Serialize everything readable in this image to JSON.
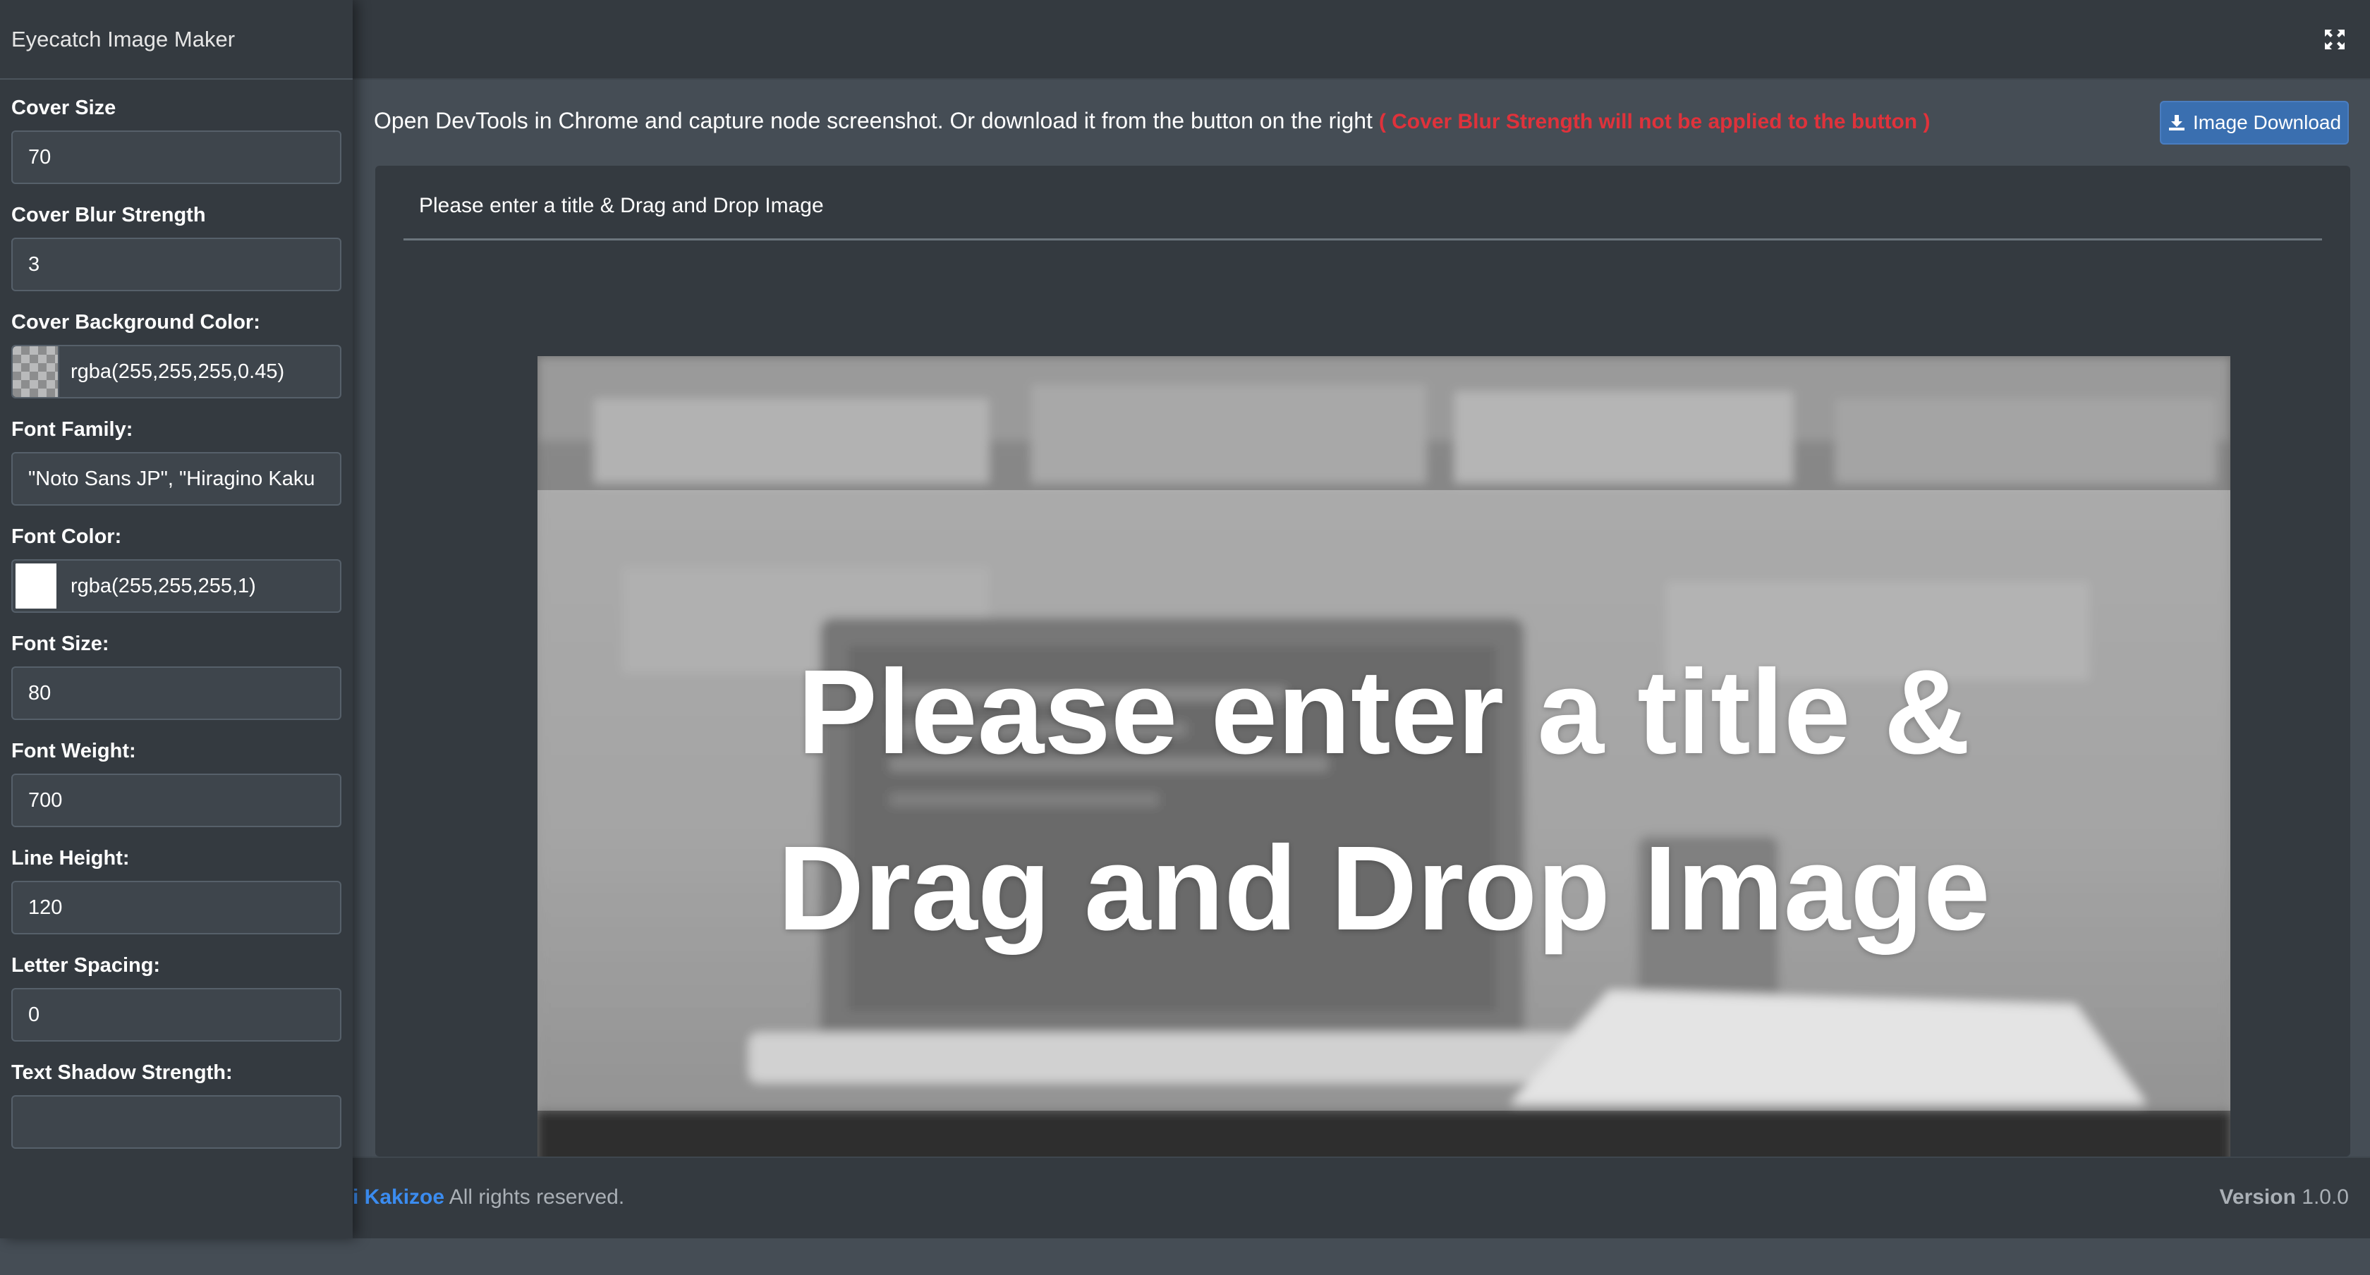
{
  "app": {
    "brand": "Eyecatch Image Maker"
  },
  "sidebar": {
    "fields": [
      {
        "label": "Cover Size",
        "value": "70"
      },
      {
        "label": "Cover Blur Strength",
        "value": "3"
      },
      {
        "label": "Cover Background Color:",
        "value": "rgba(255,255,255,0.45)"
      },
      {
        "label": "Font Family:",
        "value": "\"Noto Sans JP\", \"Hiragino Kaku"
      },
      {
        "label": "Font Color:",
        "value": "rgba(255,255,255,1)"
      },
      {
        "label": "Font Size:",
        "value": "80"
      },
      {
        "label": "Font Weight:",
        "value": "700"
      },
      {
        "label": "Line Height:",
        "value": "120"
      },
      {
        "label": "Letter Spacing:",
        "value": "0"
      },
      {
        "label": "Text Shadow Strength:",
        "value": ""
      }
    ]
  },
  "info": {
    "text": "Open DevTools in Chrome and capture node screenshot. Or download it from the button on the right",
    "warning": "( Cover Blur Strength will not be applied to the button )"
  },
  "toolbar": {
    "download_label": "Image Download"
  },
  "editor": {
    "title_value": "Please enter a title & Drag and Drop Image",
    "cover_title": "Please enter a title & Drag and Drop Image"
  },
  "footer": {
    "author": "i Kakizoe",
    "rights": "All rights reserved.",
    "version_label": "Version",
    "version_value": "1.0.0"
  },
  "colors": {
    "navbar": "#343a40",
    "content_bg": "#454d55",
    "accent_button": "#3a6fb0",
    "warning_text": "#e0323b",
    "link": "#3b8cf0"
  },
  "icons": {
    "expand": "expand-arrows-icon",
    "download": "download-icon"
  }
}
